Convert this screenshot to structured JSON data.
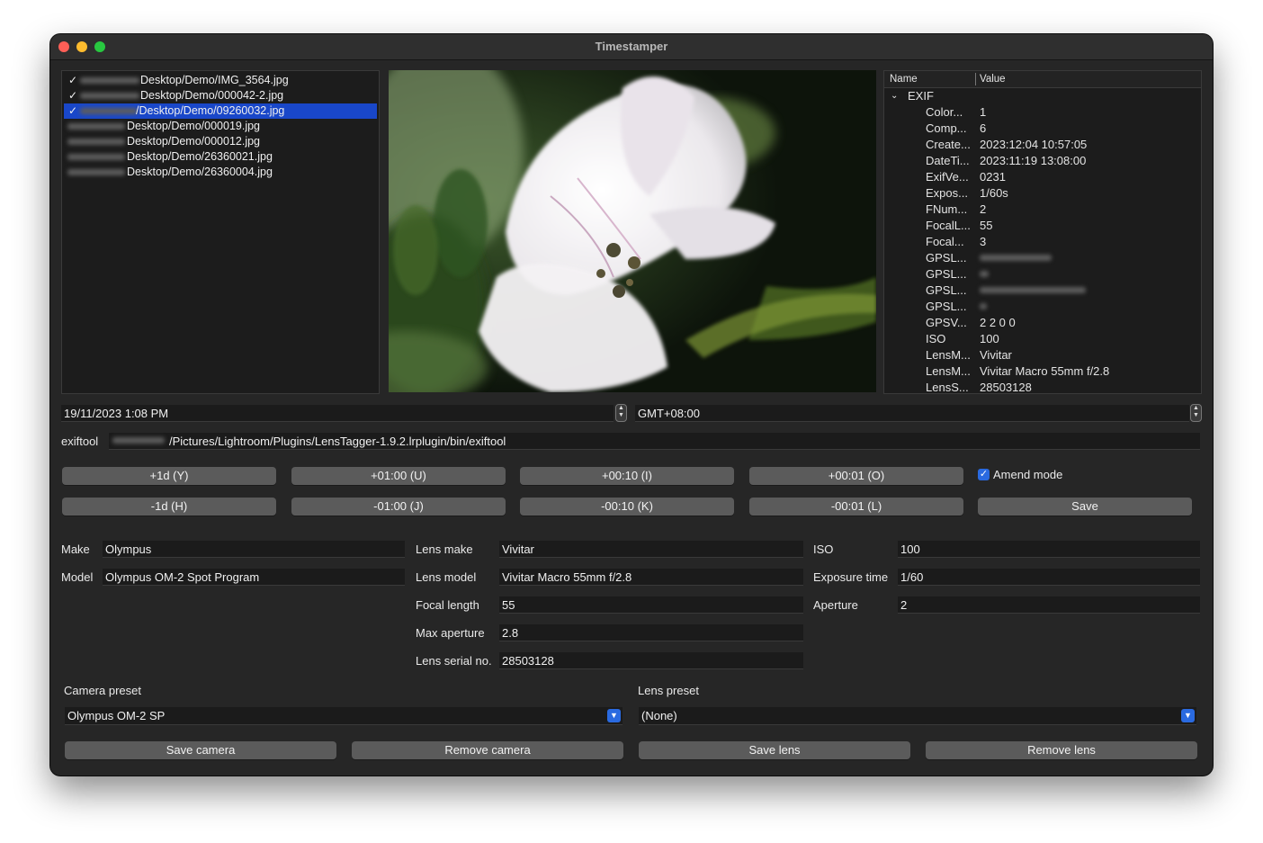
{
  "window": {
    "title": "Timestamper"
  },
  "files": [
    {
      "checked": true,
      "name": "Desktop/Demo/IMG_3564.jpg",
      "selected": false
    },
    {
      "checked": true,
      "name": "Desktop/Demo/000042-2.jpg",
      "selected": false
    },
    {
      "checked": true,
      "name": "/Desktop/Demo/09260032.jpg",
      "selected": true
    },
    {
      "checked": false,
      "name": "Desktop/Demo/000019.jpg",
      "selected": false
    },
    {
      "checked": false,
      "name": "Desktop/Demo/000012.jpg",
      "selected": false
    },
    {
      "checked": false,
      "name": "Desktop/Demo/26360021.jpg",
      "selected": false
    },
    {
      "checked": false,
      "name": "Desktop/Demo/26360004.jpg",
      "selected": false
    }
  ],
  "exif": {
    "col_name": "Name",
    "col_value": "Value",
    "group": "EXIF",
    "rows": [
      {
        "name": "Color...",
        "value": "1"
      },
      {
        "name": "Comp...",
        "value": "6"
      },
      {
        "name": "Create...",
        "value": "2023:12:04 10:57:05"
      },
      {
        "name": "DateTi...",
        "value": "2023:11:19 13:08:00"
      },
      {
        "name": "ExifVe...",
        "value": "0231"
      },
      {
        "name": "Expos...",
        "value": "1/60s"
      },
      {
        "name": "FNum...",
        "value": "2"
      },
      {
        "name": "FocalL...",
        "value": "55"
      },
      {
        "name": "Focal...",
        "value": "3"
      },
      {
        "name": "GPSL...",
        "value": ""
      },
      {
        "name": "GPSL...",
        "value": ""
      },
      {
        "name": "GPSL...",
        "value": ""
      },
      {
        "name": "GPSL...",
        "value": ""
      },
      {
        "name": "GPSV...",
        "value": "2 2 0 0"
      },
      {
        "name": "ISO",
        "value": "100"
      },
      {
        "name": "LensM...",
        "value": "Vivitar"
      },
      {
        "name": "LensM...",
        "value": "Vivitar Macro 55mm f/2.8"
      },
      {
        "name": "LensS...",
        "value": "28503128"
      }
    ]
  },
  "datetime": "19/11/2023 1:08 PM",
  "timezone": "GMT+08:00",
  "exiftool": {
    "label": "exiftool",
    "path": "/Pictures/Lightroom/Plugins/LensTagger-1.9.2.lrplugin/bin/exiftool"
  },
  "buttons": {
    "plus_day": "+1d (Y)",
    "plus_hour": "+01:00 (U)",
    "plus_10min": "+00:10 (I)",
    "plus_1min": "+00:01 (O)",
    "minus_day": "-1d (H)",
    "minus_hour": "-01:00 (J)",
    "minus_10min": "-00:10 (K)",
    "minus_1min": "-00:01 (L)",
    "save": "Save",
    "amend_mode": "Amend mode",
    "amend_checked": true
  },
  "fields": {
    "make_label": "Make",
    "make": "Olympus",
    "model_label": "Model",
    "model": "Olympus OM-2 Spot Program",
    "lens_make_label": "Lens make",
    "lens_make": "Vivitar",
    "lens_model_label": "Lens model",
    "lens_model": "Vivitar Macro 55mm f/2.8",
    "focal_length_label": "Focal length",
    "focal_length": "55",
    "max_aperture_label": "Max aperture",
    "max_aperture": "2.8",
    "lens_serial_label": "Lens serial no.",
    "lens_serial": "28503128",
    "iso_label": "ISO",
    "iso": "100",
    "exposure_label": "Exposure time",
    "exposure": "1/60",
    "aperture_label": "Aperture",
    "aperture": "2"
  },
  "presets": {
    "camera_label": "Camera preset",
    "camera_value": "Olympus OM-2 SP",
    "lens_label": "Lens preset",
    "lens_value": "(None)",
    "save_camera": "Save camera",
    "remove_camera": "Remove camera",
    "save_lens": "Save lens",
    "remove_lens": "Remove lens"
  },
  "colors": {
    "accent": "#2a6ae0",
    "selection": "#1947c9",
    "window_bg": "#262626"
  }
}
